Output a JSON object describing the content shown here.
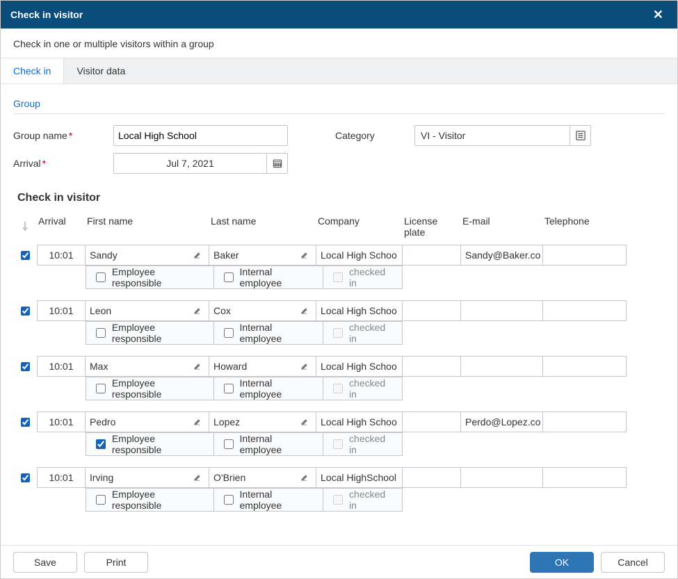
{
  "dialog": {
    "title": "Check in visitor",
    "subtitle": "Check in one or multiple visitors within a group"
  },
  "tabs": {
    "checkin": "Check in",
    "visitordata": "Visitor data"
  },
  "group": {
    "section": "Group",
    "name_label": "Group name",
    "name_value": "Local High School",
    "category_label": "Category",
    "category_value": "VI - Visitor",
    "arrival_label": "Arrival",
    "arrival_value": "Jul 7, 2021"
  },
  "grid": {
    "section": "Check in visitor",
    "headers": {
      "arrival": "Arrival",
      "first": "First name",
      "last": "Last name",
      "company": "Company",
      "license": "License plate",
      "email": "E-mail",
      "phone": "Telephone"
    },
    "sublabels": {
      "emp": "Employee responsible",
      "intemp": "Internal employee",
      "checked": "checked in"
    },
    "rows": [
      {
        "sel": true,
        "arrival": "10:01",
        "first": "Sandy",
        "last": "Baker",
        "company": "Local High School",
        "license": "",
        "email": "Sandy@Baker.com",
        "phone": "",
        "emp": false,
        "intemp": false,
        "checked": false
      },
      {
        "sel": true,
        "arrival": "10:01",
        "first": "Leon",
        "last": "Cox",
        "company": "Local High School",
        "license": "",
        "email": "",
        "phone": "",
        "emp": false,
        "intemp": false,
        "checked": false
      },
      {
        "sel": true,
        "arrival": "10:01",
        "first": "Max",
        "last": "Howard",
        "company": "Local High School",
        "license": "",
        "email": "",
        "phone": "",
        "emp": false,
        "intemp": false,
        "checked": false
      },
      {
        "sel": true,
        "arrival": "10:01",
        "first": "Pedro",
        "last": "Lopez",
        "company": "Local High School",
        "license": "",
        "email": "Perdo@Lopez.com",
        "phone": "",
        "emp": true,
        "intemp": false,
        "checked": false
      },
      {
        "sel": true,
        "arrival": "10:01",
        "first": "Irving",
        "last": "O'Brien",
        "company": "Local HighSchool",
        "license": "",
        "email": "",
        "phone": "",
        "emp": false,
        "intemp": false,
        "checked": false
      }
    ]
  },
  "footer": {
    "save": "Save",
    "print": "Print",
    "ok": "OK",
    "cancel": "Cancel"
  }
}
